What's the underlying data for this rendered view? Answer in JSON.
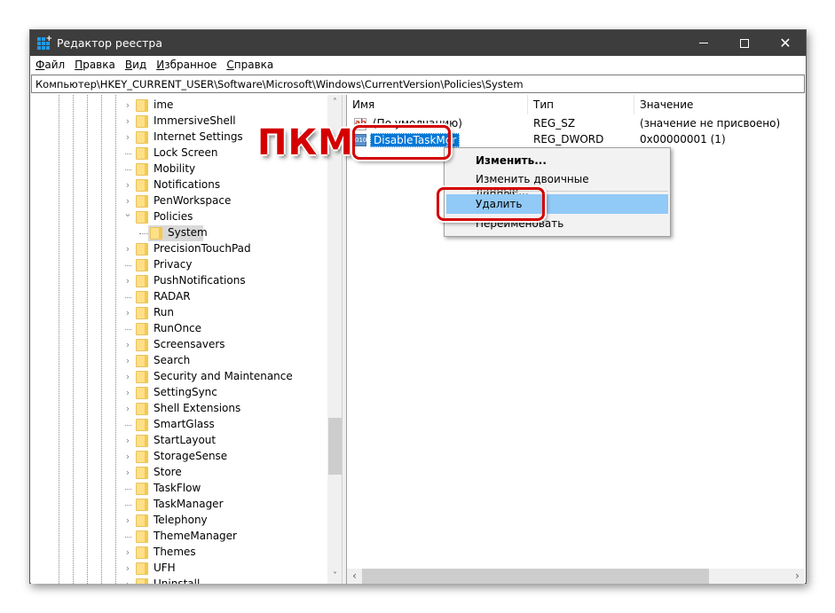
{
  "window": {
    "title": "Редактор реестра",
    "controls": {
      "minimize": "—",
      "maximize": "☐",
      "close": "✕"
    }
  },
  "menu": {
    "items": [
      {
        "label": "Файл",
        "accel": "Ф",
        "rest": "айл"
      },
      {
        "label": "Правка",
        "accel": "П",
        "rest": "равка"
      },
      {
        "label": "Вид",
        "accel": "В",
        "rest": "ид"
      },
      {
        "label": "Избранное",
        "accel": "И",
        "rest": "збранное"
      },
      {
        "label": "Справка",
        "accel": "С",
        "rest": "правка"
      }
    ]
  },
  "address": {
    "path": "Компьютер\\HKEY_CURRENT_USER\\Software\\Microsoft\\Windows\\CurrentVersion\\Policies\\System"
  },
  "tree": {
    "items": [
      {
        "label": "ime",
        "expander": "collapsed"
      },
      {
        "label": "ImmersiveShell",
        "expander": "collapsed"
      },
      {
        "label": "Internet Settings",
        "expander": "collapsed"
      },
      {
        "label": "Lock Screen",
        "expander": "none"
      },
      {
        "label": "Mobility",
        "expander": "none"
      },
      {
        "label": "Notifications",
        "expander": "collapsed"
      },
      {
        "label": "PenWorkspace",
        "expander": "collapsed"
      },
      {
        "label": "Policies",
        "expander": "expanded"
      },
      {
        "label": "System",
        "expander": "none",
        "child": true,
        "selected": true
      },
      {
        "label": "PrecisionTouchPad",
        "expander": "collapsed"
      },
      {
        "label": "Privacy",
        "expander": "none"
      },
      {
        "label": "PushNotifications",
        "expander": "collapsed"
      },
      {
        "label": "RADAR",
        "expander": "none"
      },
      {
        "label": "Run",
        "expander": "collapsed"
      },
      {
        "label": "RunOnce",
        "expander": "none"
      },
      {
        "label": "Screensavers",
        "expander": "collapsed"
      },
      {
        "label": "Search",
        "expander": "collapsed"
      },
      {
        "label": "Security and Maintenance",
        "expander": "collapsed"
      },
      {
        "label": "SettingSync",
        "expander": "collapsed"
      },
      {
        "label": "Shell Extensions",
        "expander": "collapsed"
      },
      {
        "label": "SmartGlass",
        "expander": "none"
      },
      {
        "label": "StartLayout",
        "expander": "collapsed"
      },
      {
        "label": "StorageSense",
        "expander": "collapsed"
      },
      {
        "label": "Store",
        "expander": "collapsed"
      },
      {
        "label": "TaskFlow",
        "expander": "none"
      },
      {
        "label": "TaskManager",
        "expander": "none"
      },
      {
        "label": "Telephony",
        "expander": "collapsed"
      },
      {
        "label": "ThemeManager",
        "expander": "none"
      },
      {
        "label": "Themes",
        "expander": "collapsed"
      },
      {
        "label": "UFH",
        "expander": "collapsed"
      },
      {
        "label": "Uninstall",
        "expander": "collapsed"
      }
    ]
  },
  "values": {
    "columns": {
      "name": "Имя",
      "type": "Тип",
      "value": "Значение"
    },
    "rows": [
      {
        "icon": "string-value-icon",
        "icon_text": "ab",
        "name": "(По умолчанию)",
        "type": "REG_SZ",
        "value": "(значение не присвоено)"
      },
      {
        "icon": "binary-value-icon",
        "icon_text": "010",
        "name": "DisableTaskMgr",
        "type": "REG_DWORD",
        "value": "0x00000001 (1)",
        "selected": true
      }
    ]
  },
  "context_menu": {
    "items": [
      {
        "label": "Изменить...",
        "bold": true
      },
      {
        "label": "Изменить двоичные данные..."
      },
      {
        "separator": true
      },
      {
        "label": "Удалить",
        "hover": true
      },
      {
        "label": "Переименовать"
      }
    ]
  },
  "annotation": {
    "label": "ПКМ",
    "color": "#d40000"
  },
  "scrollbars": {
    "tree_up": "˄",
    "tree_down": "˅",
    "values_left": "‹",
    "values_right": "›"
  }
}
